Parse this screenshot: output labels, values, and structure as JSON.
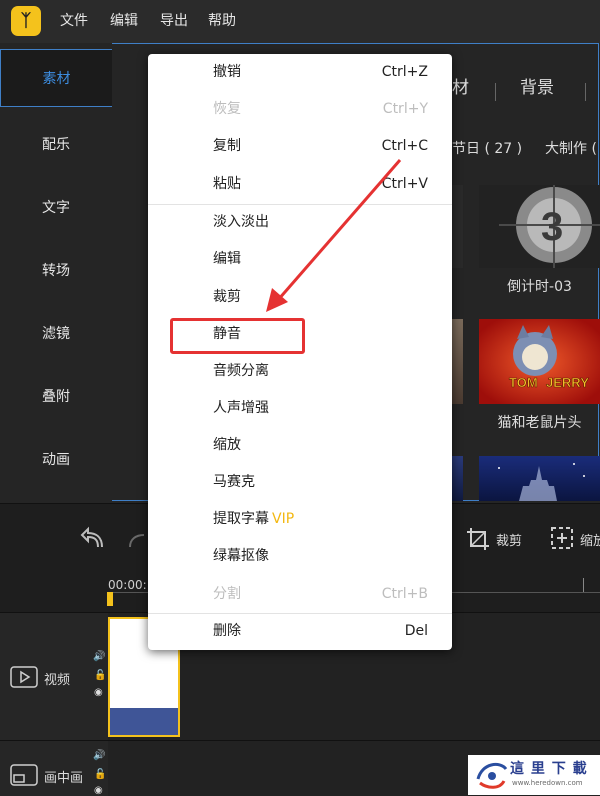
{
  "menubar": {
    "items": [
      "文件",
      "编辑",
      "导出",
      "帮助"
    ]
  },
  "sidebar": {
    "items": [
      "素材",
      "配乐",
      "文字",
      "转场",
      "滤镜",
      "叠附",
      "动画"
    ],
    "active": "素材"
  },
  "library": {
    "top_tabs": [
      "材",
      "背景"
    ],
    "sub_tabs": [
      "节日 ( 27 )",
      "大制作 ("
    ],
    "thumbnails": [
      {
        "label": "倒计时-03",
        "icon": "countdown-film-icon"
      },
      {
        "label": "猫和老鼠片头",
        "icon": "tom-and-jerry-logo",
        "logo_text": "TOM JERRY"
      }
    ]
  },
  "toolbar": {
    "crop_label": "裁剪",
    "zoom_label": "缩放"
  },
  "timeline": {
    "timecode": "00:00:",
    "tracks": [
      {
        "label": "视频",
        "icon": "video-track-icon"
      },
      {
        "label": "画中画",
        "icon": "pip-track-icon"
      }
    ]
  },
  "context_menu": {
    "items": [
      {
        "label": "撤销",
        "shortcut": "Ctrl+Z",
        "enabled": true
      },
      {
        "label": "恢复",
        "shortcut": "Ctrl+Y",
        "enabled": false
      },
      {
        "label": "复制",
        "shortcut": "Ctrl+C",
        "enabled": true
      },
      {
        "label": "粘贴",
        "shortcut": "Ctrl+V",
        "enabled": true
      },
      {
        "label": "淡入淡出",
        "shortcut": "",
        "enabled": true
      },
      {
        "label": "编辑",
        "shortcut": "",
        "enabled": true
      },
      {
        "label": "裁剪",
        "shortcut": "",
        "enabled": true
      },
      {
        "label": "静音",
        "shortcut": "",
        "enabled": true,
        "highlighted": true
      },
      {
        "label": "音频分离",
        "shortcut": "",
        "enabled": true
      },
      {
        "label": "人声增强",
        "shortcut": "",
        "enabled": true
      },
      {
        "label": "缩放",
        "shortcut": "",
        "enabled": true
      },
      {
        "label": "马赛克",
        "shortcut": "",
        "enabled": true
      },
      {
        "label": "提取字幕",
        "badge": "VIP",
        "shortcut": "",
        "enabled": true
      },
      {
        "label": "绿幕抠像",
        "shortcut": "",
        "enabled": true
      },
      {
        "label": "分割",
        "shortcut": "Ctrl+B",
        "enabled": false
      },
      {
        "label": "删除",
        "shortcut": "Del",
        "enabled": true
      }
    ]
  },
  "watermark": {
    "title": "這 里 下 載",
    "url": "www.heredown.com"
  },
  "colors": {
    "accent": "#3d8de0",
    "highlight_red": "#e53232",
    "vip_gold": "#f3b812"
  }
}
